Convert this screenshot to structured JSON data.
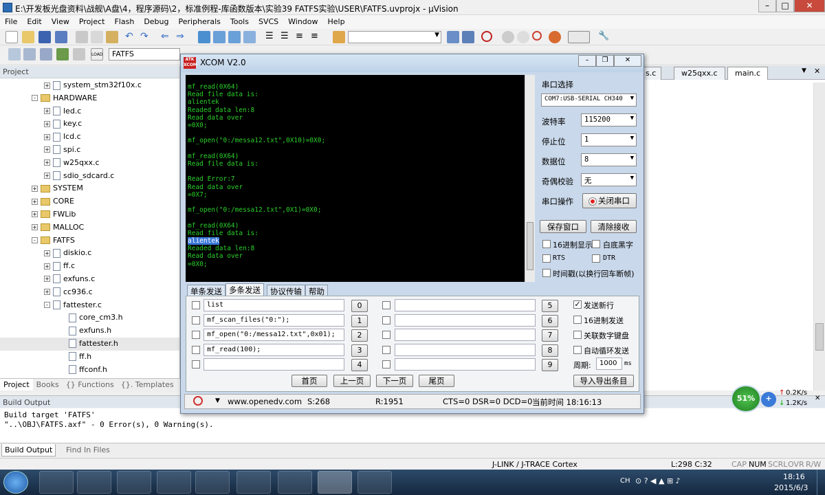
{
  "window": {
    "title": "E:\\开发板光盘资料\\战舰\\A盘\\4，程序源码\\2，标准例程-库函数版本\\实验39 FATFS实验\\USER\\FATFS.uvprojx - µVision"
  },
  "menu": [
    "File",
    "Edit",
    "View",
    "Project",
    "Flash",
    "Debug",
    "Peripherals",
    "Tools",
    "SVCS",
    "Window",
    "Help"
  ],
  "toolbar2": {
    "target": "FATFS"
  },
  "project": {
    "header": "Project",
    "items": [
      {
        "label": "system_stm32f10x.c",
        "type": "file",
        "depth": 3,
        "exp": "+"
      },
      {
        "label": "HARDWARE",
        "type": "folder",
        "depth": 2,
        "exp": "-"
      },
      {
        "label": "led.c",
        "type": "file",
        "depth": 3,
        "exp": "+"
      },
      {
        "label": "key.c",
        "type": "file",
        "depth": 3,
        "exp": "+"
      },
      {
        "label": "lcd.c",
        "type": "file",
        "depth": 3,
        "exp": "+"
      },
      {
        "label": "spi.c",
        "type": "file",
        "depth": 3,
        "exp": "+"
      },
      {
        "label": "w25qxx.c",
        "type": "file",
        "depth": 3,
        "exp": "+"
      },
      {
        "label": "sdio_sdcard.c",
        "type": "file",
        "depth": 3,
        "exp": "+"
      },
      {
        "label": "SYSTEM",
        "type": "folder",
        "depth": 2,
        "exp": "+"
      },
      {
        "label": "CORE",
        "type": "folder",
        "depth": 2,
        "exp": "+"
      },
      {
        "label": "FWLib",
        "type": "folder",
        "depth": 2,
        "exp": "+"
      },
      {
        "label": "MALLOC",
        "type": "folder",
        "depth": 2,
        "exp": "+"
      },
      {
        "label": "FATFS",
        "type": "folder",
        "depth": 2,
        "exp": "-"
      },
      {
        "label": "diskio.c",
        "type": "file",
        "depth": 3,
        "exp": "+"
      },
      {
        "label": "ff.c",
        "type": "file",
        "depth": 3,
        "exp": "+"
      },
      {
        "label": "exfuns.c",
        "type": "file",
        "depth": 3,
        "exp": "+"
      },
      {
        "label": "cc936.c",
        "type": "file",
        "depth": 3,
        "exp": "+"
      },
      {
        "label": "fattester.c",
        "type": "file",
        "depth": 3,
        "exp": "-"
      },
      {
        "label": "core_cm3.h",
        "type": "file",
        "depth": 4,
        "exp": ""
      },
      {
        "label": "exfuns.h",
        "type": "file",
        "depth": 4,
        "exp": ""
      },
      {
        "label": "fattester.h",
        "type": "file",
        "depth": 4,
        "exp": "",
        "selected": true
      },
      {
        "label": "ff.h",
        "type": "file",
        "depth": 4,
        "exp": ""
      },
      {
        "label": "ffconf.h",
        "type": "file",
        "depth": 4,
        "exp": ""
      }
    ],
    "tabs": [
      "Project",
      "Books",
      "{} Functions",
      "{}. Templates"
    ]
  },
  "editor_tabs": [
    "s.c",
    "w25qxx.c",
    "main.c"
  ],
  "build": {
    "header": "Build Output",
    "lines": [
      "Build target 'FATFS'",
      "\"..\\OBJ\\FATFS.axf\" - 0 Error(s), 0 Warning(s)."
    ],
    "tabs": [
      "Build Output",
      "Find In Files"
    ]
  },
  "status": {
    "debugger": "J-LINK / J-TRACE Cortex",
    "position": "L:298 C:32",
    "flags": [
      "CAP",
      "NUM",
      "SCRL",
      "OVR",
      "R/W"
    ]
  },
  "xcom": {
    "title": "XCOM V2.0",
    "console_before": "mf_read(0X64)\nRead file data is:\nalientek\nReaded data len:8\nRead data over\n=0X0;\n\nmf_open(\"0:/messa12.txt\",0X10)=0X0;\n\nmf_read(0X64)\nRead file data is:\n\nRead Error:7\nRead data over\n=0X7;\n\nmf_open(\"0:/messa12.txt\",0X1)=0X0;\n\nmf_read(0X64)\nRead file data is:\n",
    "console_highlight": "alientek",
    "console_after": "\nReaded data len:8\nRead data over\n=0X0;",
    "settings": {
      "port_label": "串口选择",
      "port_value": "COM7:USB-SERIAL CH340",
      "baud_label": "波特率",
      "baud_value": "115200",
      "stop_label": "停止位",
      "stop_value": "1",
      "data_label": "数据位",
      "data_value": "8",
      "parity_label": "奇偶校验",
      "parity_value": "无",
      "op_label": "串口操作",
      "op_button": "关闭串口",
      "save_button": "保存窗口",
      "clear_button": "清除接收",
      "hex_display": "16进制显示",
      "white_bg": "白底黑字",
      "rts": "RTS",
      "dtr": "DTR",
      "timestamp": "时间戳(以换行回车断帧)"
    },
    "tabs": [
      "单条发送",
      "多条发送",
      "协议传输",
      "帮助"
    ],
    "multisend": {
      "left": [
        {
          "num": "0",
          "text": "list"
        },
        {
          "num": "1",
          "text": " mf_scan_files(\"0:\");"
        },
        {
          "num": "2",
          "text": "mf_open(\"0:/messa12.txt\",0x01);"
        },
        {
          "num": "3",
          "text": "mf_read(100);"
        },
        {
          "num": "4",
          "text": ""
        }
      ],
      "right": [
        {
          "num": "5",
          "text": ""
        },
        {
          "num": "6",
          "text": ""
        },
        {
          "num": "7",
          "text": ""
        },
        {
          "num": "8",
          "text": ""
        },
        {
          "num": "9",
          "text": ""
        }
      ],
      "opts": {
        "newline": "发送新行",
        "hex": "16进制发送",
        "keypad": "关联数字键盘",
        "loop": "自动循环发送",
        "period_label": "周期:",
        "period_value": "1000",
        "period_unit": "ms"
      },
      "pager": [
        "首页",
        "上一页",
        "下一页",
        "尾页"
      ],
      "import_export": "导入导出条目"
    },
    "status": {
      "site": "www.openedv.com",
      "sent": "S:268",
      "recv": "R:1951",
      "lines": "CTS=0 DSR=0 DCD=0",
      "time": "当前时间 18:16:13"
    }
  },
  "net": {
    "percent": "51%",
    "up": "0.2K/s",
    "down": "1.2K/s"
  },
  "tray": {
    "lang": "CH",
    "time": "18:16",
    "date": "2015/6/3"
  }
}
